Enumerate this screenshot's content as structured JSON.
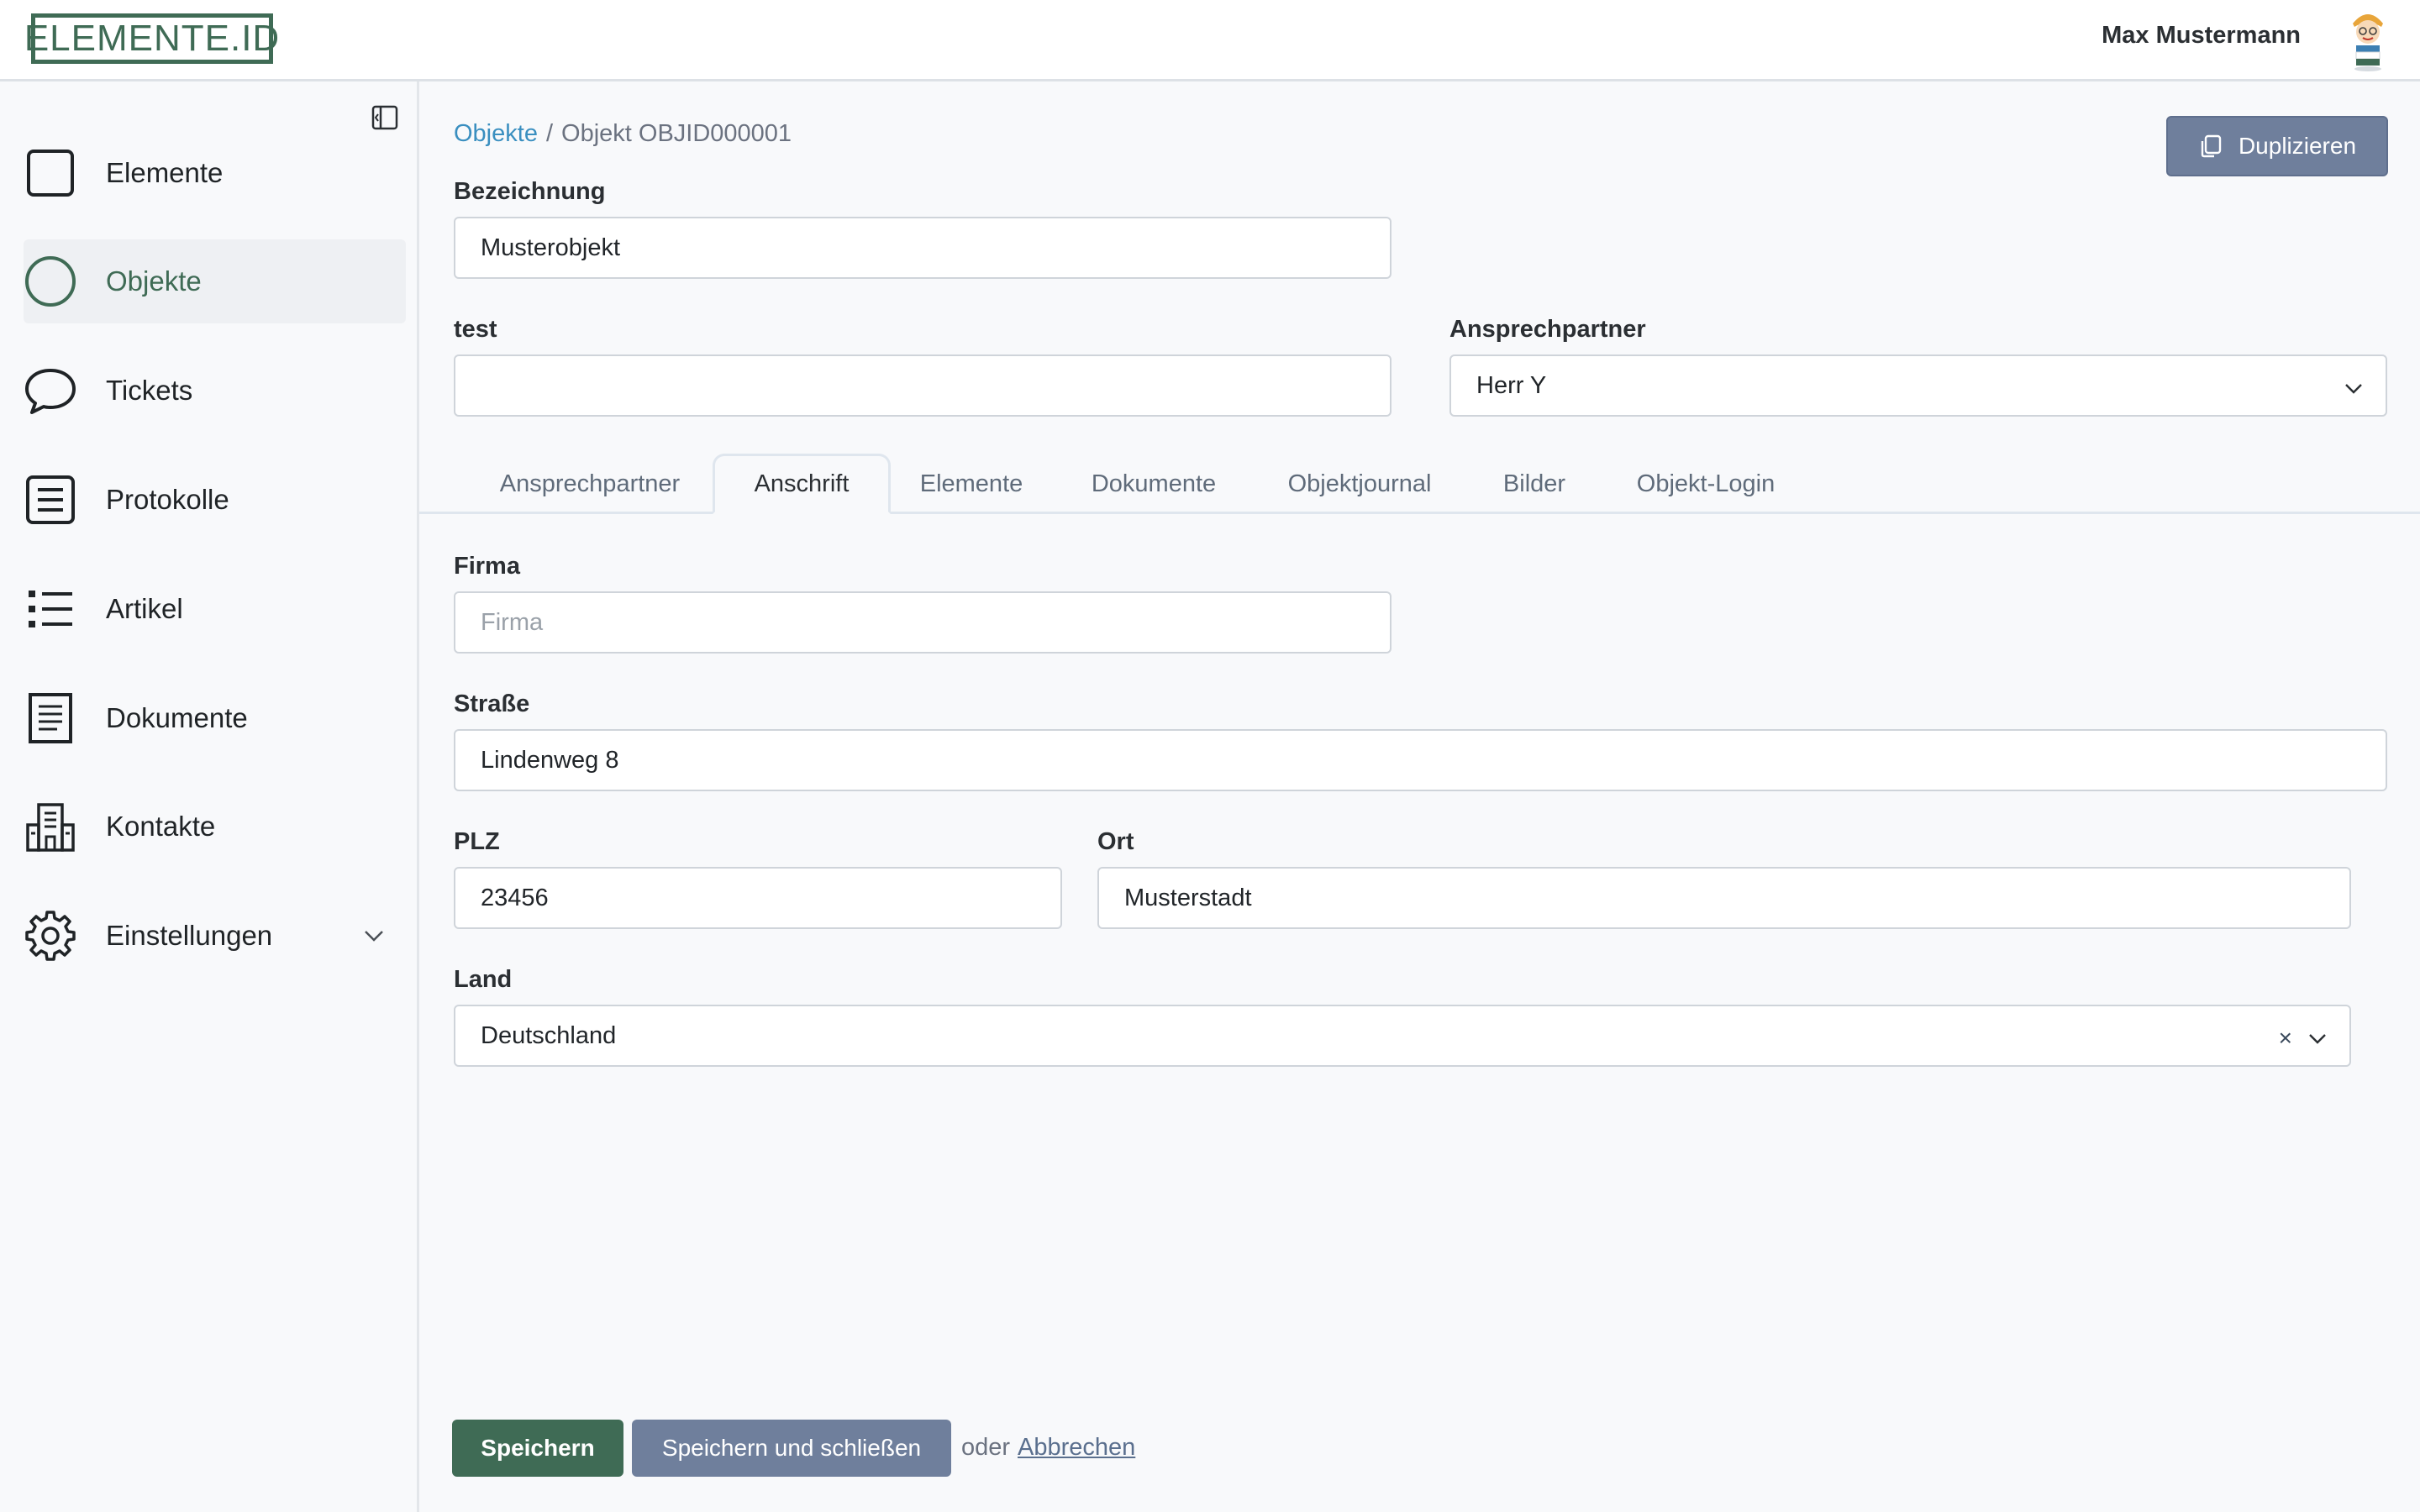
{
  "header": {
    "logo_text": "ELEMENTE.ID",
    "user_name": "Max Mustermann"
  },
  "sidebar": {
    "items": [
      {
        "label": "Elemente",
        "icon": "square-icon"
      },
      {
        "label": "Objekte",
        "icon": "circle-icon",
        "active": true
      },
      {
        "label": "Tickets",
        "icon": "chat-bubble-icon"
      },
      {
        "label": "Protokolle",
        "icon": "list-box-icon"
      },
      {
        "label": "Artikel",
        "icon": "bullet-list-icon"
      },
      {
        "label": "Dokumente",
        "icon": "document-icon"
      },
      {
        "label": "Kontakte",
        "icon": "building-icon"
      },
      {
        "label": "Einstellungen",
        "icon": "gear-icon"
      }
    ]
  },
  "breadcrumb": {
    "parent": "Objekte",
    "separator": "/",
    "current": "Objekt OBJID000001"
  },
  "actions": {
    "duplicate_label": "Duplizieren"
  },
  "form": {
    "bezeichnung": {
      "label": "Bezeichnung",
      "value": "Musterobjekt"
    },
    "test": {
      "label": "test",
      "value": ""
    },
    "ansprechpartner": {
      "label": "Ansprechpartner",
      "value": "Herr Y"
    }
  },
  "tabs": [
    "Ansprechpartner",
    "Anschrift",
    "Elemente",
    "Dokumente",
    "Objektjournal",
    "Bilder",
    "Objekt-Login"
  ],
  "active_tab": "Anschrift",
  "address": {
    "firma": {
      "label": "Firma",
      "value": "",
      "placeholder": "Firma"
    },
    "strasse": {
      "label": "Straße",
      "value": "Lindenweg 8"
    },
    "plz": {
      "label": "PLZ",
      "value": "23456"
    },
    "ort": {
      "label": "Ort",
      "value": "Musterstadt"
    },
    "land": {
      "label": "Land",
      "value": "Deutschland",
      "clear": "×"
    }
  },
  "footer": {
    "save_label": "Speichern",
    "save_close_label": "Speichern und schließen",
    "or_label": "oder",
    "cancel_label": "Abbrechen"
  },
  "colors": {
    "brand_green": "#3f6b55",
    "secondary_button": "#6f7f9c",
    "link_blue": "#3a8fc0"
  }
}
